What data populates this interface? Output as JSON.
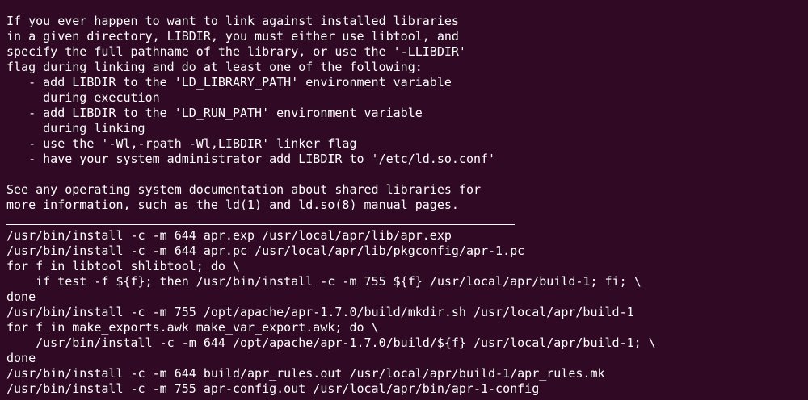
{
  "terminal": {
    "lines": [
      "If you ever happen to want to link against installed libraries",
      "in a given directory, LIBDIR, you must either use libtool, and",
      "specify the full pathname of the library, or use the '-LLIBDIR'",
      "flag during linking and do at least one of the following:",
      "   - add LIBDIR to the 'LD_LIBRARY_PATH' environment variable",
      "     during execution",
      "   - add LIBDIR to the 'LD_RUN_PATH' environment variable",
      "     during linking",
      "   - use the '-Wl,-rpath -Wl,LIBDIR' linker flag",
      "   - have your system administrator add LIBDIR to '/etc/ld.so.conf'",
      "",
      "See any operating system documentation about shared libraries for",
      "more information, such as the ld(1) and ld.so(8) manual pages."
    ],
    "lines_after_rule": [
      "/usr/bin/install -c -m 644 apr.exp /usr/local/apr/lib/apr.exp",
      "/usr/bin/install -c -m 644 apr.pc /usr/local/apr/lib/pkgconfig/apr-1.pc",
      "for f in libtool shlibtool; do \\",
      "    if test -f ${f}; then /usr/bin/install -c -m 755 ${f} /usr/local/apr/build-1; fi; \\",
      "done",
      "/usr/bin/install -c -m 755 /opt/apache/apr-1.7.0/build/mkdir.sh /usr/local/apr/build-1",
      "for f in make_exports.awk make_var_export.awk; do \\",
      "    /usr/bin/install -c -m 644 /opt/apache/apr-1.7.0/build/${f} /usr/local/apr/build-1; \\",
      "done",
      "/usr/bin/install -c -m 644 build/apr_rules.out /usr/local/apr/build-1/apr_rules.mk",
      "/usr/bin/install -c -m 755 apr-config.out /usr/local/apr/bin/apr-1-config"
    ]
  },
  "colors": {
    "background": "#300a24",
    "foreground": "#ffffff"
  }
}
